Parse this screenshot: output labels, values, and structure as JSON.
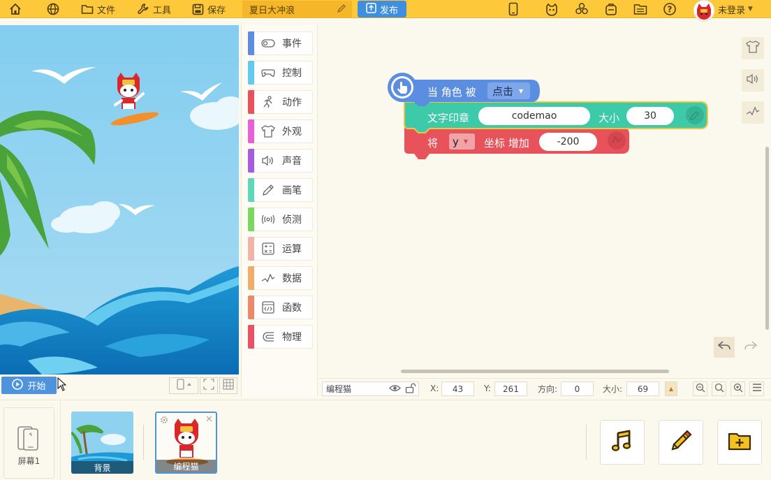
{
  "topbar": {
    "file_label": "文件",
    "tools_label": "工具",
    "save_label": "保存",
    "project_name": "夏日大冲浪",
    "publish_label": "发布",
    "login_label": "未登录"
  },
  "stage": {
    "start_label": "开始"
  },
  "categories": [
    {
      "label": "事件",
      "color": "#5b8de0",
      "icon": "toggle-icon"
    },
    {
      "label": "控制",
      "color": "#62c9f0",
      "icon": "gamepad-icon"
    },
    {
      "label": "动作",
      "color": "#e8525a",
      "icon": "running-icon"
    },
    {
      "label": "外观",
      "color": "#ea5fd6",
      "icon": "shirt-icon"
    },
    {
      "label": "声音",
      "color": "#a45be0",
      "icon": "speaker-icon"
    },
    {
      "label": "画笔",
      "color": "#5ed9b8",
      "icon": "pencil-icon"
    },
    {
      "label": "侦测",
      "color": "#7ad85e",
      "icon": "sensor-icon"
    },
    {
      "label": "运算",
      "color": "#f2b3a6",
      "icon": "calculator-icon"
    },
    {
      "label": "数据",
      "color": "#eeae6a",
      "icon": "chart-icon"
    },
    {
      "label": "函数",
      "color": "#ec8a68",
      "icon": "code-icon"
    },
    {
      "label": "物理",
      "color": "#e85262",
      "icon": "magnet-icon"
    }
  ],
  "blocks": {
    "hat": {
      "text": "当 角色 被",
      "dropdown": "点击",
      "color": "#5b8de0"
    },
    "stamp": {
      "text": "文字印章",
      "value": "codemao",
      "size_label": "大小",
      "size_value": "30",
      "color": "#3ccaa8",
      "outline": "#f2c53d"
    },
    "motion": {
      "prefix": "将",
      "axis": "y",
      "text": "坐标 增加",
      "value": "-200",
      "color": "#e8525a"
    }
  },
  "infobar": {
    "sprite_name": "编程猫",
    "x_label": "X:",
    "x_value": "43",
    "y_label": "Y:",
    "y_value": "261",
    "dir_label": "方向:",
    "dir_value": "0",
    "size_label": "大小:",
    "size_value": "69"
  },
  "bottom": {
    "screen_label": "屏幕1",
    "background_label": "背景",
    "sprite_label": "编程猫"
  },
  "colors": {
    "topbar": "#fdc83a",
    "accent": "#3f8fe0",
    "background": "#fbf8ee"
  }
}
